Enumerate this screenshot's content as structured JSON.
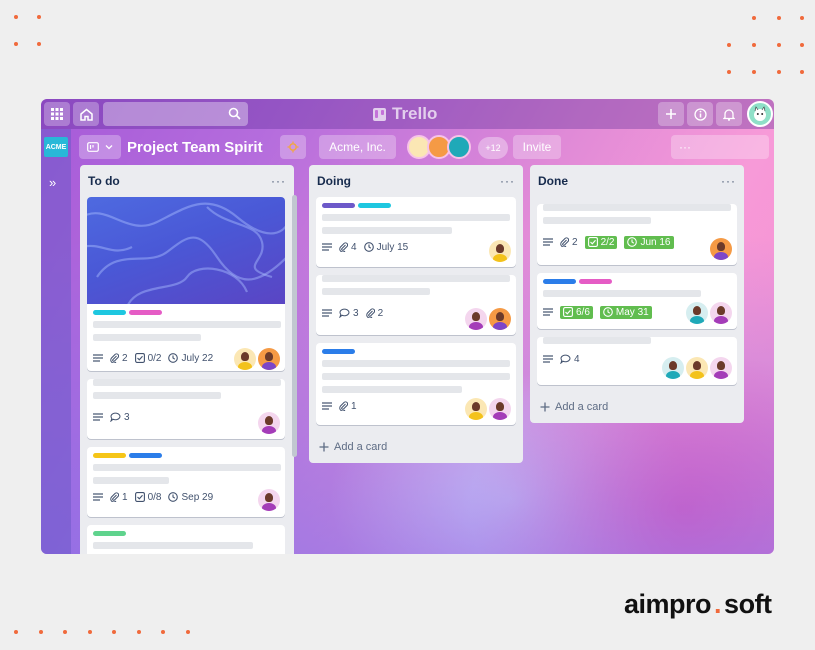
{
  "app": {
    "brand": "Trello",
    "workspace_logo": "ACME"
  },
  "colors": {
    "accent": "#f06a3c",
    "label_cyan": "#1ec7e0",
    "label_pink": "#e55cc5",
    "label_yellow": "#f5c518",
    "label_blue": "#2b7de9",
    "label_green": "#5fd38d",
    "label_purple": "#6d59c9",
    "badge_green": "#61bd4f"
  },
  "topbar": {
    "icons": [
      "apps-grid-icon",
      "home-icon",
      "search-icon",
      "plus-icon",
      "info-icon",
      "bell-icon"
    ]
  },
  "board": {
    "title": "Project Team Spirit",
    "workspace": "Acme, Inc.",
    "member_overflow": "+12",
    "invite_label": "Invite",
    "more_label": "···"
  },
  "lists": [
    {
      "title": "To do",
      "menu": "···",
      "cards": [
        {
          "labels": [
            "label_cyan",
            "label_pink"
          ],
          "attachments": "2",
          "checklist": "0/2",
          "due": "July 22",
          "avatars": [
            "yellow",
            "orange"
          ]
        },
        {
          "comments": "3",
          "avatars": [
            "pink"
          ]
        },
        {
          "labels": [
            "label_yellow",
            "label_blue"
          ],
          "attachments": "1",
          "checklist": "0/8",
          "due": "Sep 29",
          "avatars": [
            "pink"
          ]
        },
        {
          "labels": [
            "label_green"
          ]
        }
      ]
    },
    {
      "title": "Doing",
      "menu": "···",
      "add_card": "Add a card",
      "cards": [
        {
          "labels": [
            "label_purple",
            "label_cyan"
          ],
          "attachments": "4",
          "due": "July 15",
          "avatars": [
            "yellow"
          ]
        },
        {
          "comments": "3",
          "attachments": "2",
          "avatars": [
            "pink",
            "orange"
          ]
        },
        {
          "labels": [
            "label_blue"
          ],
          "attachments": "1",
          "avatars": [
            "yellow",
            "pink"
          ]
        }
      ]
    },
    {
      "title": "Done",
      "menu": "···",
      "add_card": "Add a card",
      "cards": [
        {
          "attachments": "2",
          "checklist": "2/2",
          "due": "Jun 16",
          "avatars": [
            "orange"
          ]
        },
        {
          "labels": [
            "label_blue",
            "label_pink"
          ],
          "checklist": "6/6",
          "due": "May 31",
          "avatars": [
            "teal",
            "pink"
          ]
        },
        {
          "comments": "4",
          "avatars": [
            "teal",
            "yellow",
            "pink"
          ]
        }
      ]
    }
  ],
  "footer": {
    "brand_left": "aimpro",
    "brand_right": "soft"
  }
}
